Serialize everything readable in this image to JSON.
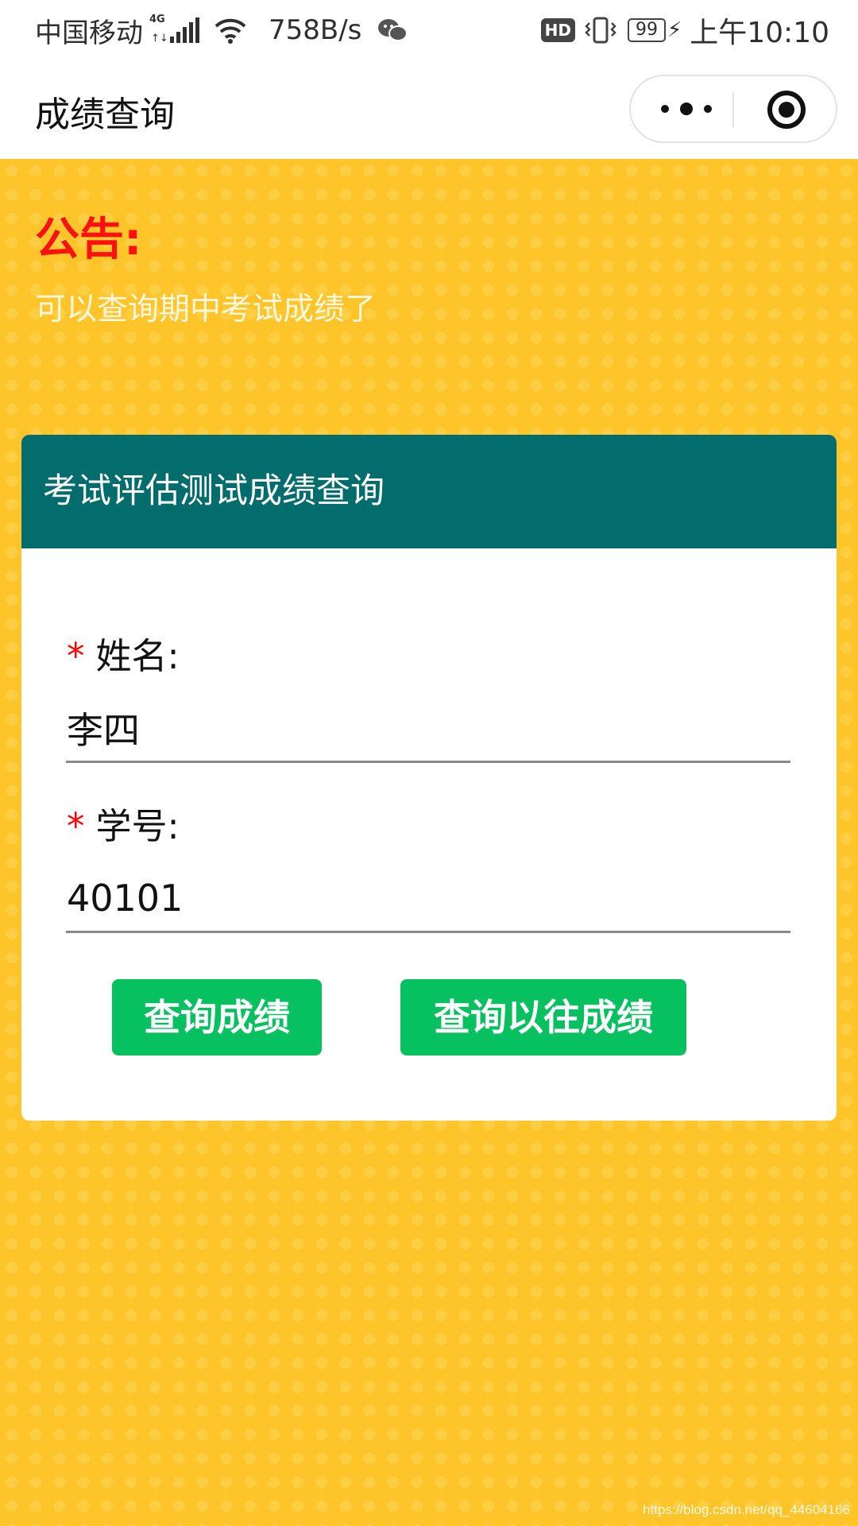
{
  "status_bar": {
    "carrier": "中国移动",
    "network_tag": "4G",
    "network_arrows": "↑↓",
    "speed": "758B/s",
    "hd_label": "HD",
    "battery": "99",
    "time": "上午10:10",
    "icons": [
      "signal-icon",
      "wifi-icon",
      "wechat-icon",
      "vibrate-icon",
      "battery-icon",
      "charging-icon"
    ]
  },
  "nav": {
    "title": "成绩查询"
  },
  "notice": {
    "title": "公告:",
    "text": "可以查询期中考试成绩了"
  },
  "form": {
    "header": "考试评估测试成绩查询",
    "required_mark": "*",
    "name_label": "姓名:",
    "name_value": "李四",
    "id_label": "学号:",
    "id_value": "40101"
  },
  "buttons": {
    "query": "查询成绩",
    "query_history": "查询以往成绩"
  },
  "watermark": "https://blog.csdn.net/qq_44604166",
  "colors": {
    "background": "#fdc529",
    "header": "#036d6e",
    "notice_title": "#ff1010",
    "required": "#ff0000",
    "button": "#07c160"
  }
}
